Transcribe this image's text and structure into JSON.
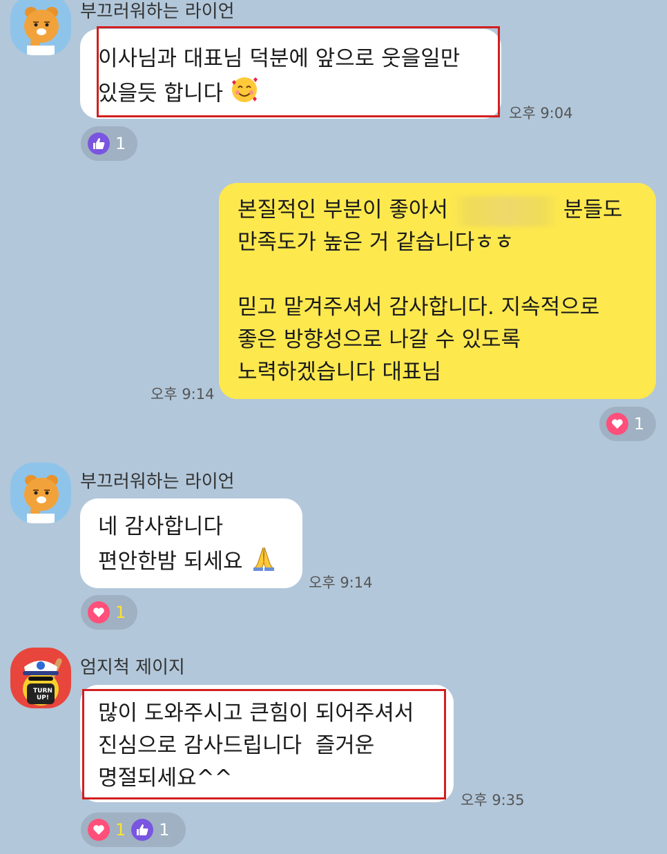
{
  "messages": [
    {
      "sender": "부끄러워하는 라이언",
      "lines": [
        "이사님과 대표님 덕분에 앞으로 웃을일만",
        "있을듯 합니다"
      ],
      "emoji": "smiling-face-with-hearts",
      "time": "오후 9:04",
      "reactions": [
        {
          "type": "like",
          "count": "1"
        }
      ]
    },
    {
      "sender": "me",
      "lines": [
        "본질적인 부분이 좋아서",
        "분들도",
        "만족도가 높은 거 같습니다ㅎㅎ",
        "",
        "믿고 맡겨주셔서 감사합니다. 지속적으로",
        "좋은 방향성으로 나갈 수 있도록",
        "노력하겠습니다 대표님"
      ],
      "time": "오후 9:14",
      "reactions": [
        {
          "type": "heart",
          "count": "1"
        }
      ]
    },
    {
      "sender": "부끄러워하는 라이언",
      "lines": [
        "네 감사합니다",
        "편안한밤 되세요"
      ],
      "emoji": "folded-hands",
      "time": "오후 9:14",
      "reactions": [
        {
          "type": "heart",
          "count": "1"
        }
      ]
    },
    {
      "sender": "엄지척 제이지",
      "lines": [
        "많이 도와주시고 큰힘이 되어주셔서",
        "진심으로 감사드립니다  즐거운",
        "명절되세요^^"
      ],
      "time": "오후 9:35",
      "reactions": [
        {
          "type": "heart",
          "count": "1"
        },
        {
          "type": "like",
          "count": "1"
        }
      ]
    }
  ],
  "avatar_badge": "TURN UP!",
  "colors": {
    "background": "#b2c7da",
    "my_bubble": "#fde84e",
    "other_bubble": "#ffffff",
    "highlight": "#d21e1e",
    "heart": "#ff4f7a",
    "like": "#7a55e0"
  }
}
